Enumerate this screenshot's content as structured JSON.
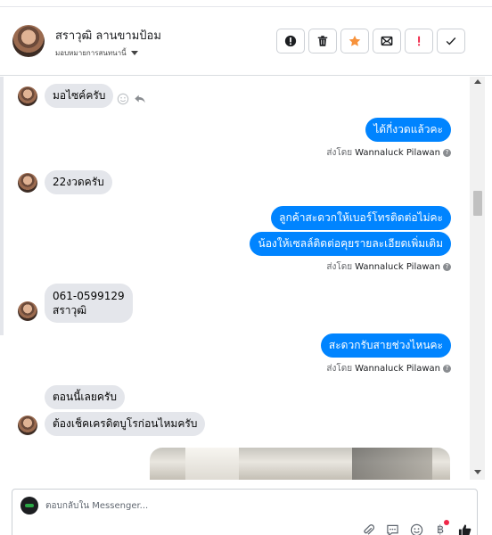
{
  "header": {
    "contact_name": "สราวุฒิ ลานขามป้อม",
    "assign_label": "มอบหมายการสนทนานี้",
    "actions": [
      {
        "name": "follow-up-button",
        "icon": "exclamation-circle-icon"
      },
      {
        "name": "delete-button",
        "icon": "trash-icon"
      },
      {
        "name": "star-button",
        "icon": "star-icon"
      },
      {
        "name": "mark-unread-button",
        "icon": "envelope-icon"
      },
      {
        "name": "spam-button",
        "icon": "exclamation-icon"
      },
      {
        "name": "done-button",
        "icon": "check-icon"
      }
    ]
  },
  "messages": {
    "m1": "มอไซค์ครับ",
    "m2": "ได้กี่งวดแล้วคะ",
    "m3": "22งวดครับ",
    "m4": "ลูกค้าสะดวกให้เบอร์โทรติดต่อไม่คะ",
    "m5": "น้องให้เซลล์ติดต่อคุยรายละเอียดเพิ่มเติม",
    "m6_line1": "061-0599129",
    "m6_line2": "สราวุฒิ",
    "m7": "สะดวกรับสายช่วงไหนคะ",
    "m8": "ตอนนี้เลยครับ",
    "m9": "ต้องเช็คเครดิตบูโรก่อนไหมครับ"
  },
  "sent_by": {
    "prefix": "ส่งโดย",
    "name": "Wannaluck Pilawan"
  },
  "composer": {
    "placeholder": "ตอบกลับใน Messenger..."
  },
  "colors": {
    "outgoing_bubble": "#0084ff",
    "incoming_bubble": "#e4e6eb",
    "star": "#f7923b",
    "spam": "#f02849"
  }
}
